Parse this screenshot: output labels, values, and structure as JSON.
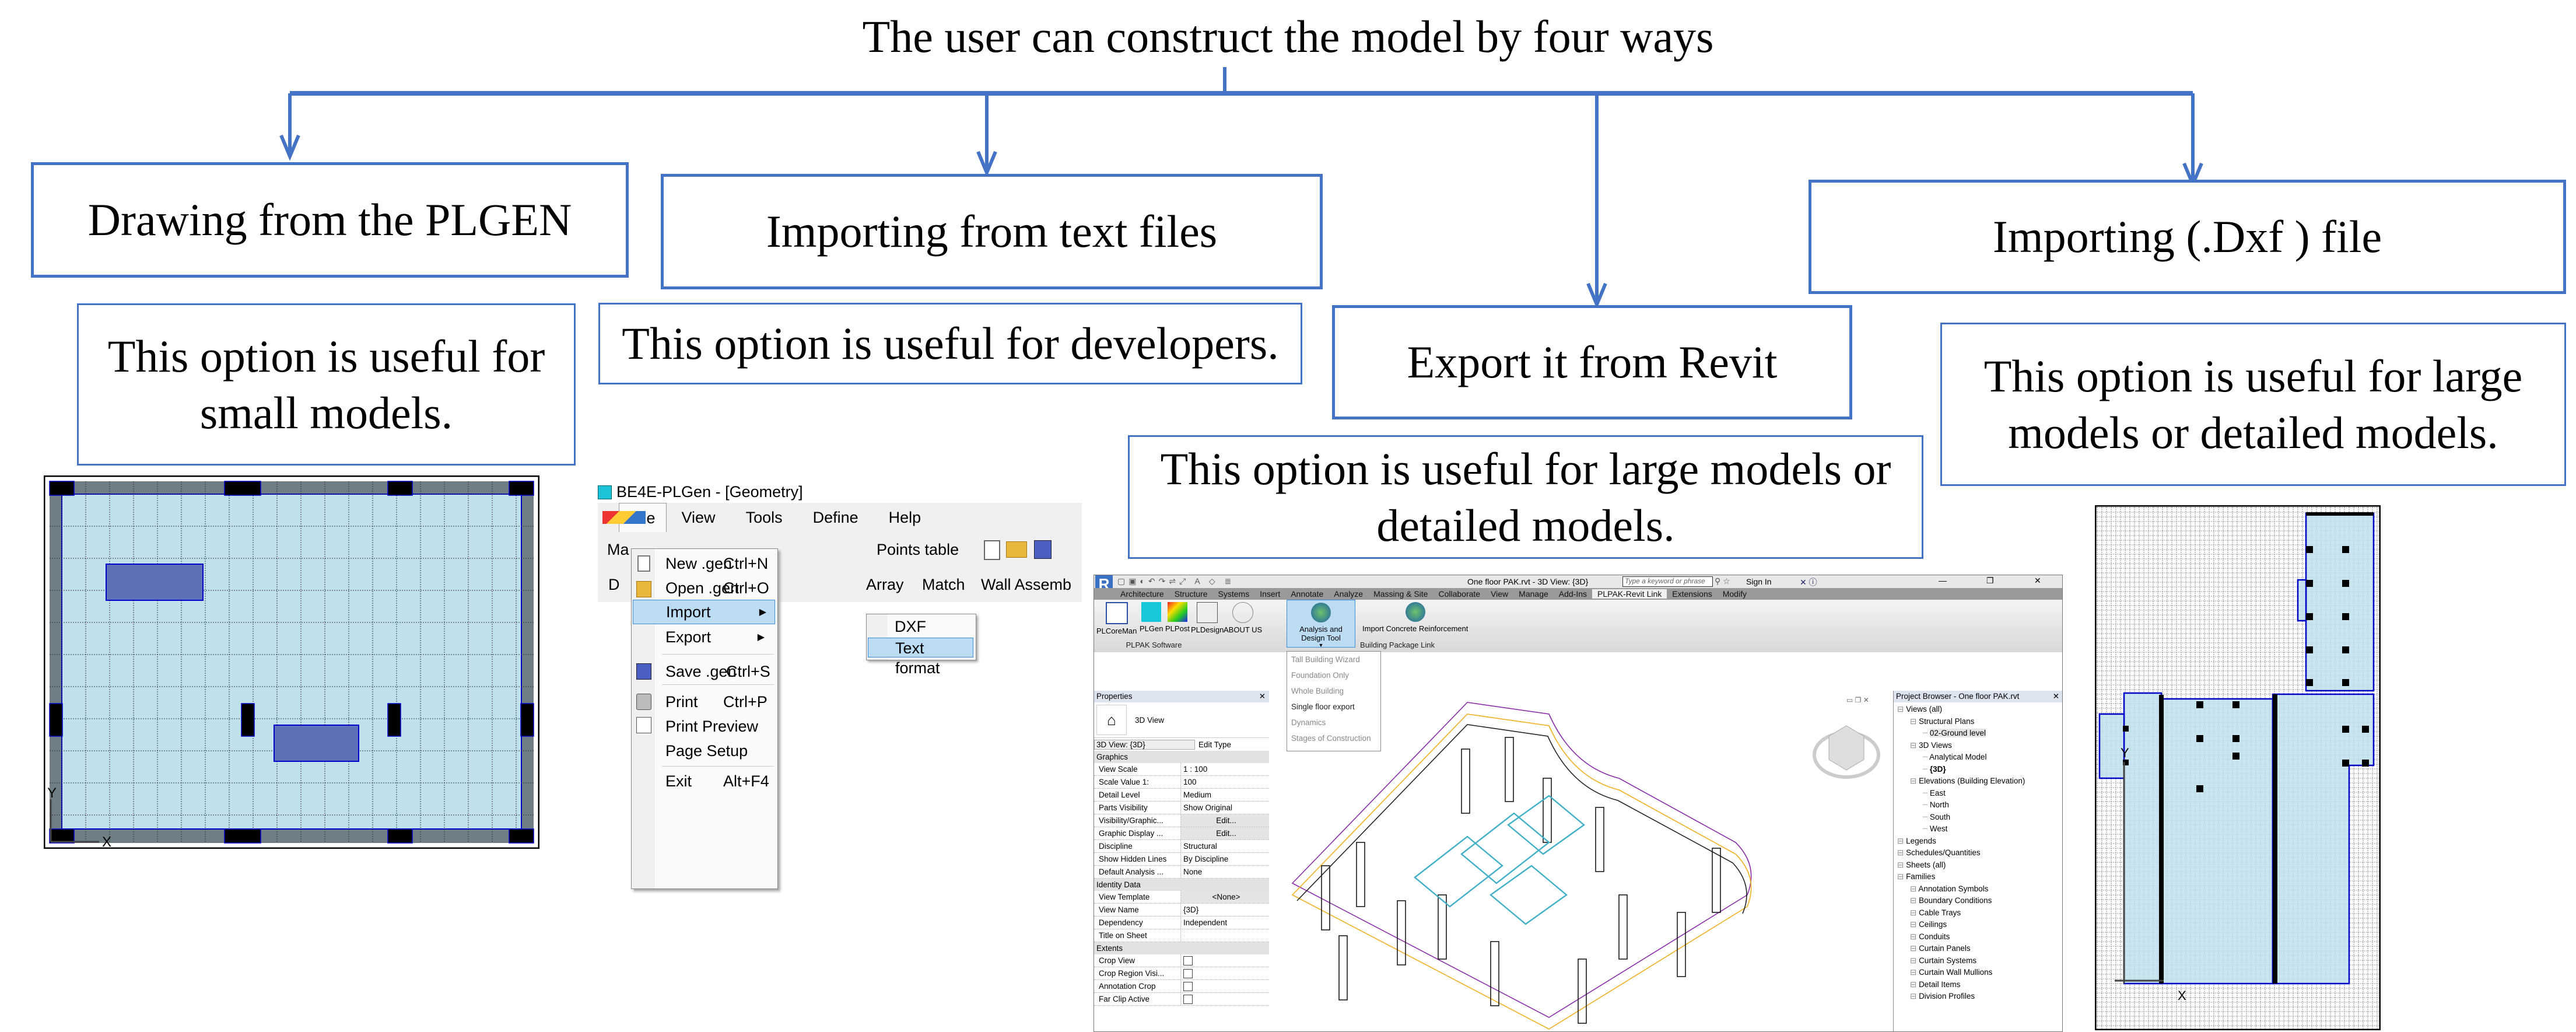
{
  "header": {
    "title": "The user can construct the model by four ways"
  },
  "ways": [
    {
      "label": "Drawing from the PLGEN",
      "note": "This option is useful for small models."
    },
    {
      "label": "Importing from text files",
      "note": "This option is useful for developers."
    },
    {
      "label": "Export it from Revit",
      "note": "This option is useful for large models or detailed models."
    },
    {
      "label": "Importing (.Dxf ) file",
      "note": "This option is useful for large models or detailed models."
    }
  ],
  "colors": {
    "connector": "#4472C4",
    "slab": "#C0E0EC",
    "wall": "#6E7E84",
    "opening": "#6070B8",
    "plan_line": "#0000CC"
  },
  "plgen_plan": {
    "axis_x": "X",
    "axis_y": "Y"
  },
  "plgen": {
    "window_title": "BE4E-PLGen - [Geometry]",
    "menubar": [
      "File",
      "View",
      "Tools",
      "Define",
      "Help"
    ],
    "toolbar1": {
      "left_clip": "Ma",
      "points_table": "Points table"
    },
    "toolbar2": {
      "left_clip": "D",
      "items": [
        "Array",
        "Match",
        "Wall Assemb"
      ]
    },
    "file_menu": [
      {
        "label": "New .gen",
        "shortcut": "Ctrl+N",
        "icon": "new-file-icon"
      },
      {
        "label": "Open .gen",
        "shortcut": "Ctrl+O",
        "icon": "open-folder-icon"
      },
      {
        "label": "Import",
        "shortcut": "",
        "submenu": true,
        "selected": true
      },
      {
        "label": "Export",
        "shortcut": "",
        "submenu": true
      },
      {
        "label": "Save .gen",
        "shortcut": "Ctrl+S",
        "icon": "save-icon"
      },
      {
        "label": "Print",
        "shortcut": "Ctrl+P",
        "icon": "printer-icon"
      },
      {
        "label": "Print Preview",
        "shortcut": "",
        "icon": "print-preview-icon"
      },
      {
        "label": "Page Setup",
        "shortcut": ""
      },
      {
        "label": "Exit",
        "shortcut": "Alt+F4"
      }
    ],
    "import_submenu": [
      {
        "label": "DXF"
      },
      {
        "label": "Text format",
        "selected": true
      }
    ]
  },
  "revit": {
    "doc_title": "One floor PAK.rvt - 3D View: {3D}",
    "search_placeholder": "Type a keyword or phrase",
    "sign_in": "Sign In",
    "tabs": [
      "Architecture",
      "Structure",
      "Systems",
      "Insert",
      "Annotate",
      "Analyze",
      "Massing & Site",
      "Collaborate",
      "View",
      "Manage",
      "Add-Ins",
      "PLPAK-Revit Link",
      "Extensions",
      "Modify"
    ],
    "active_tab": "PLPAK-Revit Link",
    "ribbon_buttons": [
      "PLCoreMan",
      "PLGen",
      "PLPost",
      "PLDesign",
      "ABOUT US",
      "Analysis and Design Tool",
      "Import Concrete Reinforcement"
    ],
    "panels": [
      "PLPAK Software",
      "Building Package Link"
    ],
    "dropdown": [
      {
        "label": "Tall Building Wizard",
        "enabled": false
      },
      {
        "label": "Foundation Only",
        "enabled": false
      },
      {
        "label": "Whole Building",
        "enabled": false
      },
      {
        "label": "Single floor export",
        "enabled": true
      },
      {
        "label": "Dynamics",
        "enabled": false
      },
      {
        "label": "Stages of Construction",
        "enabled": false
      }
    ],
    "properties": {
      "title": "Properties",
      "type": "3D View",
      "selector": "3D View: {3D}",
      "edit_type": "Edit Type",
      "groups": [
        {
          "name": "Graphics",
          "rows": [
            {
              "k": "View Scale",
              "v": "1 : 100"
            },
            {
              "k": "Scale Value    1:",
              "v": "100"
            },
            {
              "k": "Detail Level",
              "v": "Medium"
            },
            {
              "k": "Parts Visibility",
              "v": "Show Original"
            },
            {
              "k": "Visibility/Graphic...",
              "v": "Edit..."
            },
            {
              "k": "Graphic Display ...",
              "v": "Edit..."
            },
            {
              "k": "Discipline",
              "v": "Structural"
            },
            {
              "k": "Show Hidden Lines",
              "v": "By Discipline"
            },
            {
              "k": "Default Analysis ...",
              "v": "None"
            }
          ]
        },
        {
          "name": "Identity Data",
          "rows": [
            {
              "k": "View Template",
              "v": "<None>"
            },
            {
              "k": "View Name",
              "v": "{3D}"
            },
            {
              "k": "Dependency",
              "v": "Independent"
            },
            {
              "k": "Title on Sheet",
              "v": ""
            }
          ]
        },
        {
          "name": "Extents",
          "rows": [
            {
              "k": "Crop View",
              "v": "",
              "checkbox": true
            },
            {
              "k": "Crop Region Visi...",
              "v": "",
              "checkbox": true
            },
            {
              "k": "Annotation Crop",
              "v": "",
              "checkbox": true
            },
            {
              "k": "Far Clip Active",
              "v": "",
              "checkbox": true
            }
          ]
        }
      ]
    },
    "project_browser": {
      "title": "Project Browser - One floor PAK.rvt",
      "nodes": [
        {
          "label": "Views (all)",
          "level": 0
        },
        {
          "label": "Structural Plans",
          "level": 1
        },
        {
          "label": "02-Ground level",
          "level": 2
        },
        {
          "label": "3D Views",
          "level": 1
        },
        {
          "label": "Analytical Model",
          "level": 2
        },
        {
          "label": "{3D}",
          "level": 2
        },
        {
          "label": "Elevations (Building Elevation)",
          "level": 1
        },
        {
          "label": "East",
          "level": 2
        },
        {
          "label": "North",
          "level": 2
        },
        {
          "label": "South",
          "level": 2
        },
        {
          "label": "West",
          "level": 2
        },
        {
          "label": "Legends",
          "level": 0
        },
        {
          "label": "Schedules/Quantities",
          "level": 0
        },
        {
          "label": "Sheets (all)",
          "level": 0
        },
        {
          "label": "Families",
          "level": 0
        },
        {
          "label": "Annotation Symbols",
          "level": 1
        },
        {
          "label": "Boundary Conditions",
          "level": 1
        },
        {
          "label": "Cable Trays",
          "level": 1
        },
        {
          "label": "Ceilings",
          "level": 1
        },
        {
          "label": "Conduits",
          "level": 1
        },
        {
          "label": "Curtain Panels",
          "level": 1
        },
        {
          "label": "Curtain Systems",
          "level": 1
        },
        {
          "label": "Curtain Wall Mullions",
          "level": 1
        },
        {
          "label": "Detail Items",
          "level": 1
        },
        {
          "label": "Division Profiles",
          "level": 1
        }
      ]
    }
  },
  "dxf_plan": {
    "axis_x": "X",
    "axis_y": "Y"
  }
}
